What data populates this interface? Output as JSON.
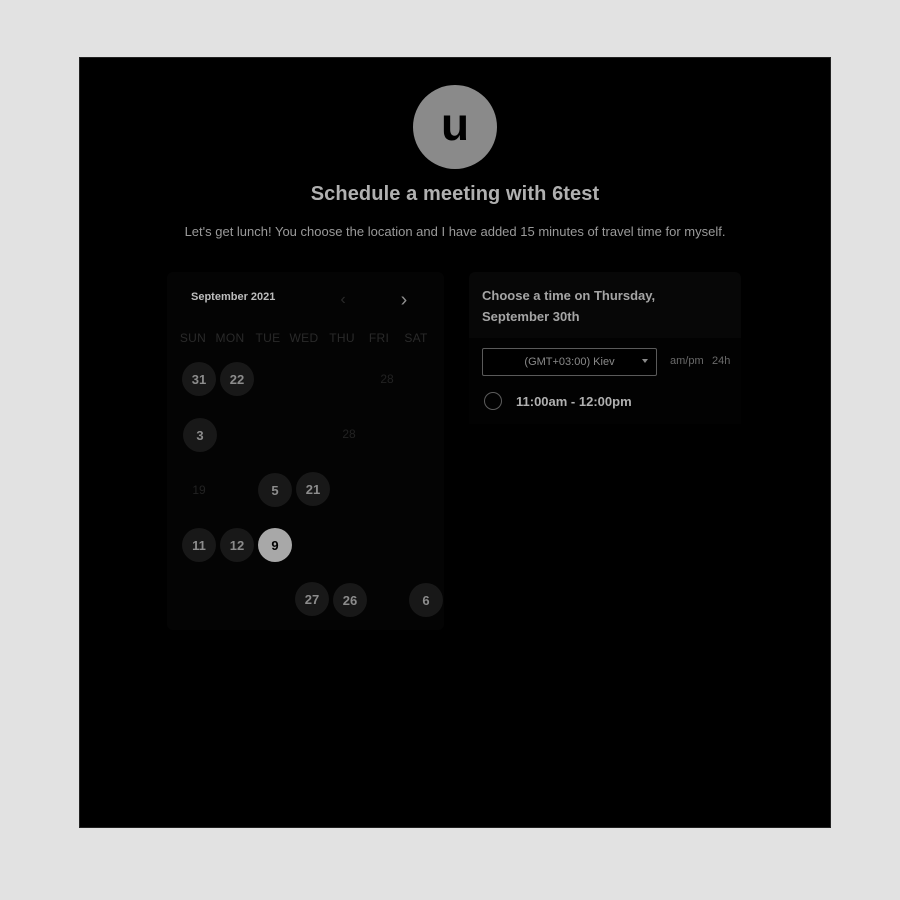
{
  "profile": {
    "avatar_letter": "u"
  },
  "header": {
    "title": "Schedule a meeting with 6test",
    "description": "Let's get lunch! You choose the location and I have added 15 minutes of travel time for myself."
  },
  "calendar": {
    "month_label": "September 2021",
    "prev_glyph": "‹",
    "next_glyph": "›",
    "weekdays": [
      "SUN",
      "MON",
      "TUE",
      "WED",
      "THU",
      "FRI",
      "SAT"
    ],
    "days": {
      "d31": "31",
      "d22": "22",
      "d28a": "28",
      "d3": "3",
      "d28b": "28",
      "d19": "19",
      "d5": "5",
      "d21": "21",
      "d11": "11",
      "d12": "12",
      "d9": "9",
      "d27": "27",
      "d26": "26",
      "d6": "6"
    }
  },
  "time_panel": {
    "title": "Choose a time on Thursday, September 30th",
    "timezone": "(GMT+03:00) Kiev",
    "format_ampm": "am/pm",
    "format_24h": "24h",
    "slots": [
      {
        "label": "11:00am - 12:00pm"
      }
    ]
  }
}
